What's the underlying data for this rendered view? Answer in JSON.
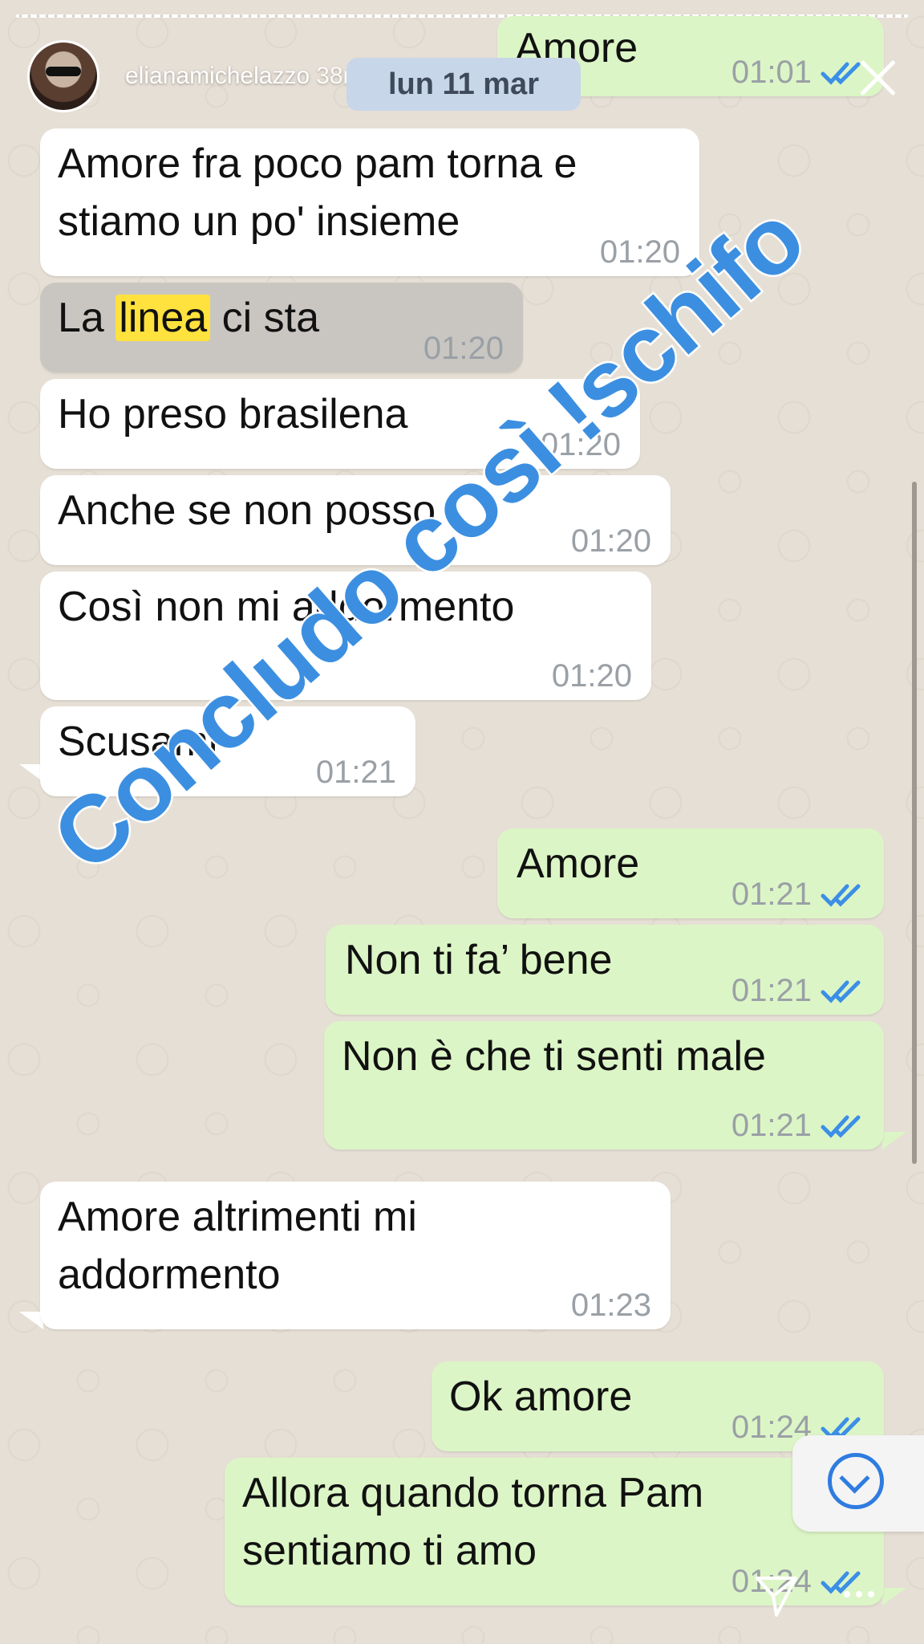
{
  "header": {
    "username": "elianamichelazzo",
    "time": "38m",
    "date_pill": "lun 11 mar"
  },
  "overlay": {
    "text": "Concludo così !schifo"
  },
  "messages": [
    {
      "text": "Amore",
      "time": "01:01",
      "dir": "out"
    },
    {
      "text": "Amore fra poco pam torna e stiamo un po' insieme",
      "time": "01:20",
      "dir": "in"
    },
    {
      "text_pre": "La ",
      "text_hl": "linea",
      "text_post": " ci sta",
      "time": "01:20",
      "dir": "in"
    },
    {
      "text": "Ho preso brasilena",
      "time": "01:20",
      "dir": "in"
    },
    {
      "text": "Anche se non posso",
      "time": "01:20",
      "dir": "in"
    },
    {
      "text": "Così non mi addormento",
      "time": "01:20",
      "dir": "in"
    },
    {
      "text": "Scusami",
      "time": "01:21",
      "dir": "in"
    },
    {
      "text": "Amore",
      "time": "01:21",
      "dir": "out"
    },
    {
      "text": "Non ti fa’ bene",
      "time": "01:21",
      "dir": "out"
    },
    {
      "text": "Non è che ti senti male",
      "time": "01:21",
      "dir": "out"
    },
    {
      "text": "Amore altrimenti mi addormento",
      "time": "01:23",
      "dir": "in"
    },
    {
      "text": "Ok amore",
      "time": "01:24",
      "dir": "out"
    },
    {
      "text": "Allora quando torna Pam sentiamo ti amo",
      "time": "01:24",
      "dir": "out"
    }
  ],
  "icons": {
    "close": "close-icon",
    "scroll_down": "chevron-down-icon",
    "send": "send-icon",
    "more": "more-icon",
    "read_receipt": "double-check-icon"
  },
  "colors": {
    "incoming_bubble": "#ffffff",
    "outgoing_bubble": "#dcf5c6",
    "overlay_text": "#3c8fe0",
    "highlight": "#ffe23d",
    "read_tick": "#3b8fe6"
  }
}
